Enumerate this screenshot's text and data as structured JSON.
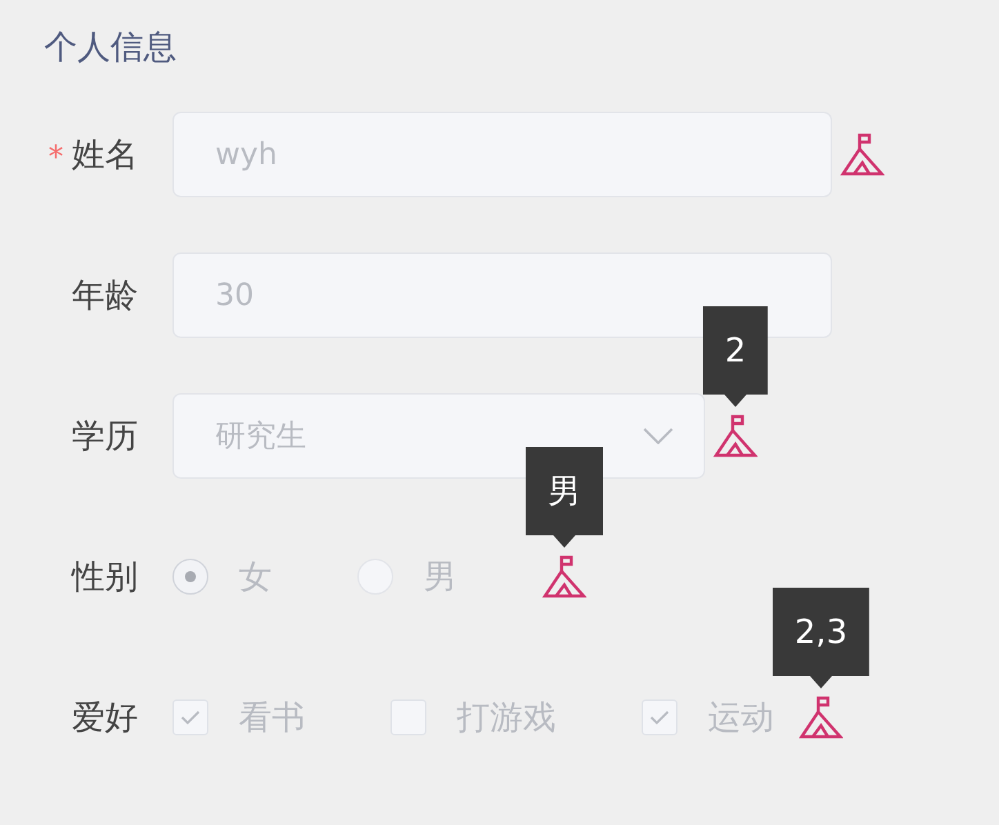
{
  "title": "个人信息",
  "fields": [
    {
      "kind": "text",
      "label": "姓名",
      "required_mark": "*",
      "value": "wyh",
      "flag_icon": true
    },
    {
      "kind": "text",
      "label": "年龄",
      "value": "30",
      "flag_icon": false
    },
    {
      "kind": "select",
      "label": "学历",
      "value": "研究生",
      "flag_icon": true,
      "tooltip": "2"
    },
    {
      "kind": "radio",
      "label": "性别",
      "flag_icon": true,
      "tooltip": "男",
      "options": [
        {
          "label": "女",
          "selected": true
        },
        {
          "label": "男",
          "selected": false
        }
      ]
    },
    {
      "kind": "checkbox",
      "label": "爱好",
      "flag_icon": true,
      "tooltip": "2,3",
      "options": [
        {
          "label": "看书",
          "checked": true
        },
        {
          "label": "打游戏",
          "checked": false
        },
        {
          "label": "运动",
          "checked": true
        }
      ]
    }
  ]
}
